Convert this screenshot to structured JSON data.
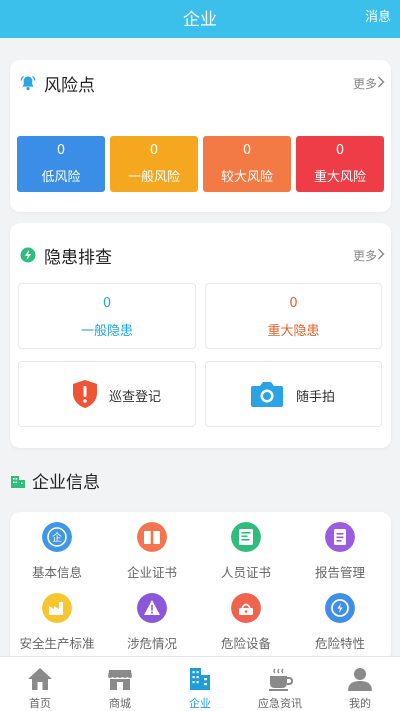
{
  "header": {
    "title": "企业",
    "messages_label": "消息"
  },
  "risk": {
    "title": "风险点",
    "more_label": "更多",
    "levels": [
      {
        "count": "0",
        "label": "低风险",
        "color": "#3a8ee6"
      },
      {
        "count": "0",
        "label": "一般风险",
        "color": "#f5a81f"
      },
      {
        "count": "0",
        "label": "较大风险",
        "color": "#f47a45"
      },
      {
        "count": "0",
        "label": "重大风险",
        "color": "#ee3d46"
      }
    ]
  },
  "hazard": {
    "title": "隐患排查",
    "more_label": "更多",
    "general": {
      "count": "0",
      "label": "一般隐患",
      "color": "#22a6dc"
    },
    "major": {
      "count": "0",
      "label": "重大隐患",
      "color": "#e8612b"
    },
    "actions": [
      {
        "label": "巡查登记",
        "icon": "shield-alert-icon"
      },
      {
        "label": "随手拍",
        "icon": "camera-icon"
      }
    ]
  },
  "enterprise": {
    "title": "企业信息",
    "items": [
      {
        "label": "基本信息",
        "icon": "enterprise-info-icon",
        "color": "#3f97e8"
      },
      {
        "label": "企业证书",
        "icon": "certificate-book-icon",
        "color": "#f2754f"
      },
      {
        "label": "人员证书",
        "icon": "personnel-certificate-icon",
        "color": "#2ebd7d"
      },
      {
        "label": "报告管理",
        "icon": "report-icon",
        "color": "#9a5ce0"
      },
      {
        "label": "安全生产标准",
        "icon": "factory-icon",
        "color": "#f7c52f"
      },
      {
        "label": "涉危情况",
        "icon": "warning-icon",
        "color": "#8c58d9"
      },
      {
        "label": "危险设备",
        "icon": "equipment-icon",
        "color": "#f0644e"
      },
      {
        "label": "危险特性",
        "icon": "hazard-property-icon",
        "color": "#3f8fe8"
      }
    ]
  },
  "tabs": [
    {
      "label": "首页",
      "icon": "home-icon",
      "active": false
    },
    {
      "label": "商城",
      "icon": "store-icon",
      "active": false
    },
    {
      "label": "企业",
      "icon": "enterprise-icon",
      "active": true
    },
    {
      "label": "应急资讯",
      "icon": "news-icon",
      "active": false
    },
    {
      "label": "我的",
      "icon": "profile-icon",
      "active": false
    }
  ]
}
